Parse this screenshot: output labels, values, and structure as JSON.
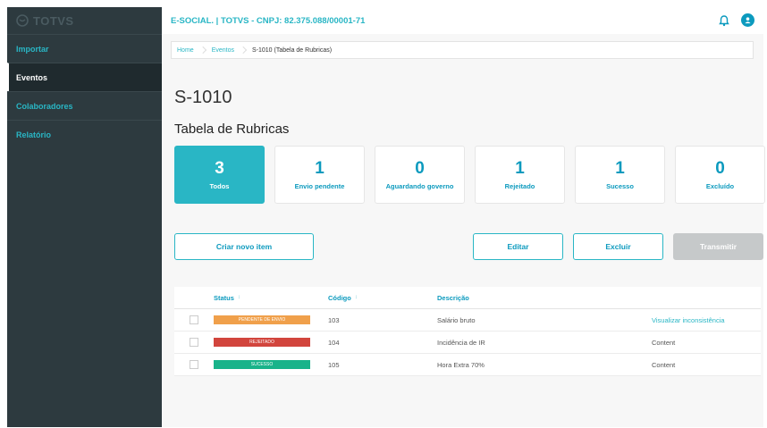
{
  "app": {
    "logo": "TOTVS"
  },
  "sidebar": {
    "items": [
      {
        "label": "Importar",
        "active": false
      },
      {
        "label": "Eventos",
        "active": true
      },
      {
        "label": "Colaboradores",
        "active": false
      },
      {
        "label": "Relatório",
        "active": false
      }
    ]
  },
  "header": {
    "title": "E-SOCIAL. | TOTVS - CNPJ: 82.375.088/00001-71"
  },
  "breadcrumb": [
    "Home",
    "Eventos",
    "S-1010 (Tabela de Rubricas)"
  ],
  "page": {
    "title": "S-1010",
    "subtitle": "Tabela de Rubricas"
  },
  "cards": [
    {
      "num": "3",
      "label": "Todos"
    },
    {
      "num": "1",
      "label": "Envio pendente"
    },
    {
      "num": "0",
      "label": "Aguardando governo"
    },
    {
      "num": "1",
      "label": "Rejeitado"
    },
    {
      "num": "1",
      "label": "Sucesso"
    },
    {
      "num": "0",
      "label": "Excluído"
    }
  ],
  "actions": {
    "create": "Criar novo item",
    "edit": "Editar",
    "delete": "Excluir",
    "transmit": "Transmitir"
  },
  "table": {
    "headers": {
      "status": "Status",
      "code": "Código",
      "desc": "Descrição",
      "sort": "↕"
    },
    "rows": [
      {
        "status": "PENDENTE DE ENVIO",
        "status_color": "#f0a04b",
        "code": "103",
        "desc": "Salário bruto",
        "extra": "Visualizar inconsistência"
      },
      {
        "status": "REJEITADO",
        "status_color": "#d2453d",
        "code": "104",
        "desc": "Incidência de IR",
        "extra": "Content"
      },
      {
        "status": "SUCESSO",
        "status_color": "#19b38a",
        "code": "105",
        "desc": "Hora Extra 70%",
        "extra": "Content"
      }
    ]
  },
  "colors": {
    "accent": "#29b6c5",
    "sidebar": "#2d3a3f"
  }
}
